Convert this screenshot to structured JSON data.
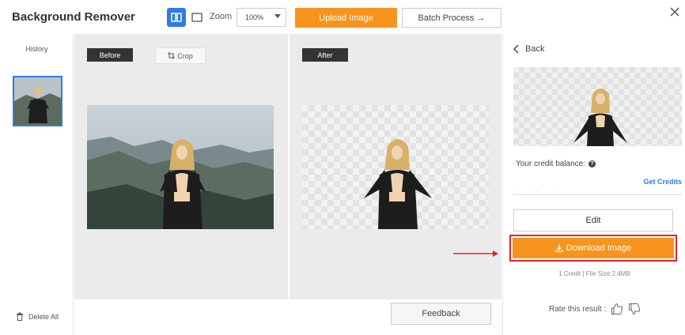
{
  "header": {
    "title": "Background Remover",
    "zoom_label": "Zoom",
    "zoom_value": "100%",
    "upload_label": "Upload Image",
    "batch_label": "Batch Process →"
  },
  "sidebar": {
    "history_label": "History",
    "delete_all_label": "Delete All"
  },
  "canvas": {
    "before_label": "Before",
    "crop_label": "Crop",
    "after_label": "After"
  },
  "footer": {
    "feedback_label": "Feedback"
  },
  "panel": {
    "back_label": "Back",
    "credit_balance_label": "Your credit balance:",
    "get_credits_label": "Get Credits",
    "edit_label": "Edit",
    "download_label": "Download Image",
    "credit_info": "1 Credit | File Size:2.4MB",
    "rate_label": "Rate this result :"
  },
  "colors": {
    "accent_orange": "#f7941d",
    "accent_blue": "#2f7be5",
    "highlight_red": "#e02424"
  }
}
